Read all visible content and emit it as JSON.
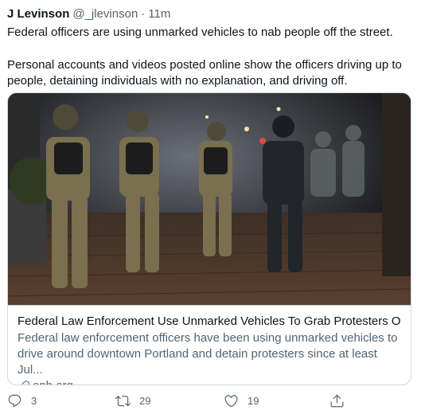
{
  "tweet": {
    "display_name": "J Levinson",
    "handle": "@_jlevinson",
    "separator": "·",
    "time": "11m",
    "text_line1": "Federal officers are using unmarked vehicles to nab people off the street.",
    "text_line2": "Personal accounts and videos posted online show the officers driving up to people, detaining individuals with no explanation, and driving off."
  },
  "card": {
    "title": "Federal Law Enforcement Use Unmarked Vehicles To Grab Protesters Off...",
    "description": "Federal law enforcement officers have been using unmarked vehicles to drive around downtown Portland and detain protesters since at least Jul...",
    "domain": "opb.org",
    "image_icon": "news-photo"
  },
  "actions": {
    "reply_count": "3",
    "retweet_count": "29",
    "like_count": "19",
    "reply_icon": "reply-icon",
    "retweet_icon": "retweet-icon",
    "like_icon": "heart-icon",
    "share_icon": "share-icon"
  },
  "colors": {
    "text_primary": "#0f1419",
    "text_secondary": "#536471",
    "border": "#cfd9de"
  }
}
